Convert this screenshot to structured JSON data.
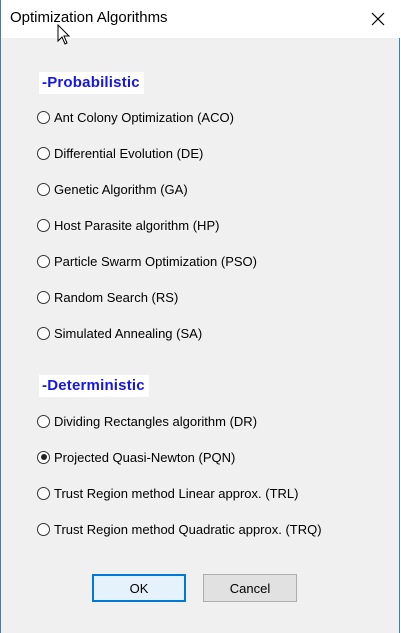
{
  "window": {
    "title": "Optimization Algorithms"
  },
  "sections": {
    "probabilistic": {
      "label": "-Probabilistic",
      "options": [
        {
          "label": "Ant Colony Optimization (ACO)",
          "checked": false
        },
        {
          "label": "Differential Evolution (DE)",
          "checked": false
        },
        {
          "label": "Genetic Algorithm (GA)",
          "checked": false
        },
        {
          "label": "Host Parasite algorithm (HP)",
          "checked": false
        },
        {
          "label": "Particle Swarm Optimization (PSO)",
          "checked": false
        },
        {
          "label": "Random Search (RS)",
          "checked": false
        },
        {
          "label": "Simulated Annealing (SA)",
          "checked": false
        }
      ]
    },
    "deterministic": {
      "label": "-Deterministic",
      "options": [
        {
          "label": "Dividing Rectangles algorithm (DR)",
          "checked": false
        },
        {
          "label": "Projected Quasi-Newton (PQN)",
          "checked": true
        },
        {
          "label": "Trust Region method Linear approx. (TRL)",
          "checked": false
        },
        {
          "label": "Trust Region method Quadratic approx. (TRQ)",
          "checked": false
        }
      ]
    }
  },
  "buttons": {
    "ok": "OK",
    "cancel": "Cancel"
  },
  "colors": {
    "section_header": "#1515e6",
    "dialog_bg": "#f0f0f0",
    "focus_border": "#0078d7"
  }
}
